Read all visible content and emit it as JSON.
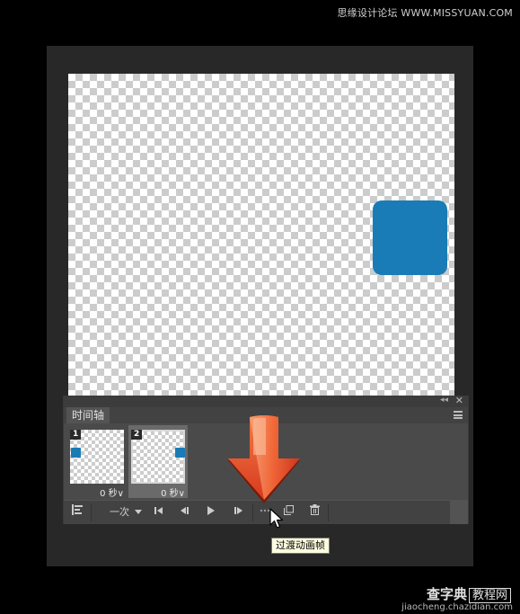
{
  "watermark_top": "思缘设计论坛 WWW.MISSYUAN.COM",
  "panel": {
    "tab_label": "时间轴",
    "collapse_glyph": "◂◂",
    "close_glyph": "✕"
  },
  "frames": [
    {
      "number": "1",
      "delay": "0 秒∨",
      "selected": false
    },
    {
      "number": "2",
      "delay": "0 秒∨",
      "selected": true
    }
  ],
  "controls": {
    "loop_value": "一次",
    "tooltip": "过渡动画帧"
  },
  "colors": {
    "shape_blue": "#1a7cb6",
    "arrow_orange": "#e8502a"
  },
  "watermark_bottom": {
    "site": "查字典",
    "tag": "教程网",
    "url": "jiaocheng.chazidian.com"
  }
}
